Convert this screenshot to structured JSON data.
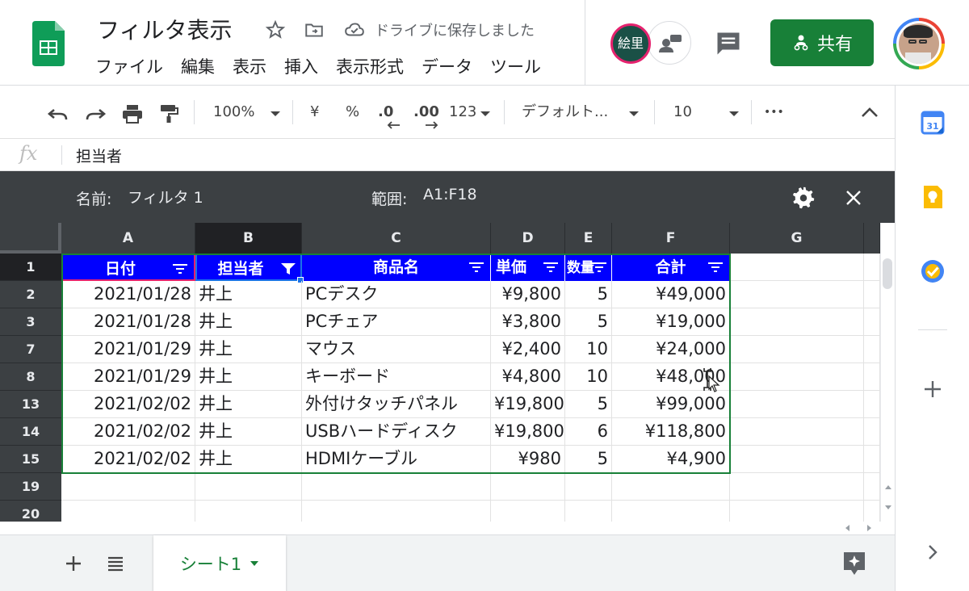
{
  "header": {
    "title": "フィルタ表示",
    "saved_status": "ドライブに保存しました",
    "menu": [
      "ファイル",
      "編集",
      "表示",
      "挿入",
      "表示形式",
      "データ",
      "ツール"
    ],
    "collaborator_avatar_text": "絵里",
    "share_label": "共有",
    "share_color": "#188038"
  },
  "toolbar": {
    "zoom": "100%",
    "currency": "¥",
    "percent": "%",
    "dec_decrease": ".0",
    "dec_increase": ".00",
    "number_format": "123",
    "font": "デフォルト...",
    "font_size": "10",
    "more": "•••"
  },
  "formula_bar": {
    "icon": "fx",
    "value": "担当者"
  },
  "filter_view": {
    "name_label": "名前:",
    "name": "フィルタ 1",
    "range_label": "範囲:",
    "range": "A1:F18"
  },
  "grid": {
    "columns": [
      "A",
      "B",
      "C",
      "D",
      "E",
      "F",
      "G"
    ],
    "header_row": {
      "row_num": "1",
      "cells": [
        "日付",
        "担当者",
        "商品名",
        "単価",
        "数量",
        "合計"
      ],
      "fill_color": "#0000ff"
    },
    "rows": [
      {
        "num": "2",
        "cells": [
          "2021/01/28",
          "井上",
          "PCデスク",
          "¥9,800",
          "5",
          "¥49,000"
        ]
      },
      {
        "num": "3",
        "cells": [
          "2021/01/28",
          "井上",
          "PCチェア",
          "¥3,800",
          "5",
          "¥19,000"
        ]
      },
      {
        "num": "7",
        "cells": [
          "2021/01/29",
          "井上",
          "マウス",
          "¥2,400",
          "10",
          "¥24,000"
        ]
      },
      {
        "num": "8",
        "cells": [
          "2021/01/29",
          "井上",
          "キーボード",
          "¥4,800",
          "10",
          "¥48,000"
        ]
      },
      {
        "num": "13",
        "cells": [
          "2021/02/02",
          "井上",
          "外付けタッチパネル",
          "¥19,800",
          "5",
          "¥99,000"
        ]
      },
      {
        "num": "14",
        "cells": [
          "2021/02/02",
          "井上",
          "USBハードディスク",
          "¥19,800",
          "6",
          "¥118,800"
        ]
      },
      {
        "num": "15",
        "cells": [
          "2021/02/02",
          "井上",
          "HDMIケーブル",
          "¥980",
          "5",
          "¥4,900"
        ]
      }
    ],
    "empty_rows": [
      "19",
      "20"
    ]
  },
  "sheets": {
    "active": "シート1"
  }
}
